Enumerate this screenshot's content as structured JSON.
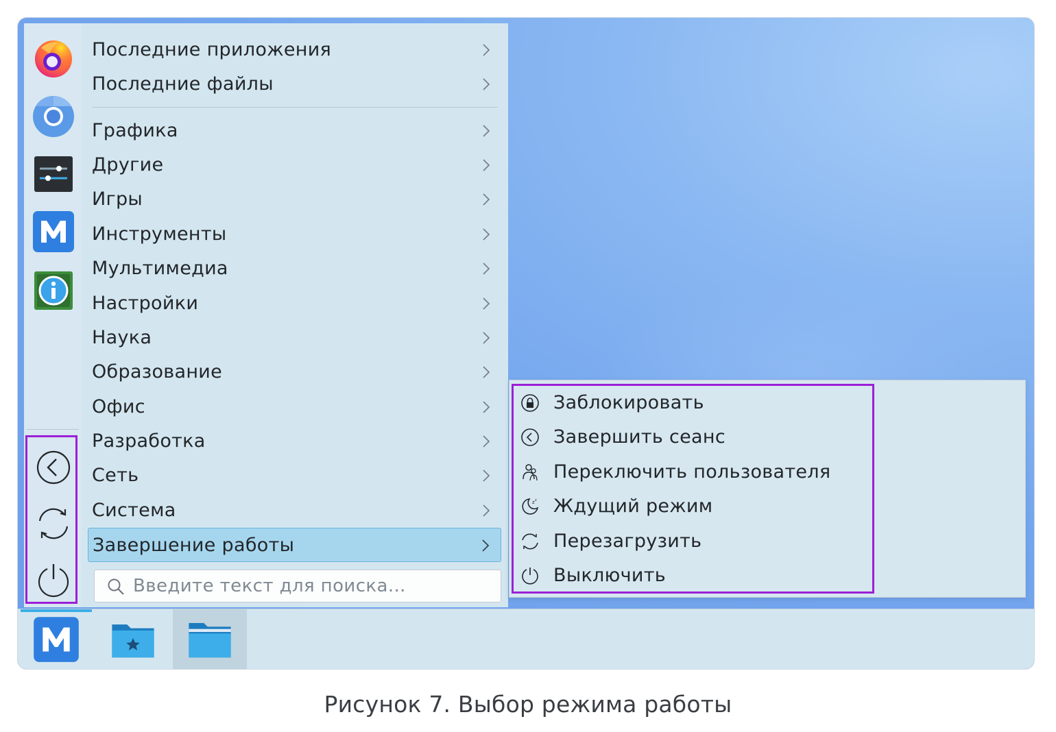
{
  "menu": {
    "categories": [
      {
        "label": "Последние приложения"
      },
      {
        "label": "Последние файлы"
      },
      {
        "label": "Графика"
      },
      {
        "label": "Другие"
      },
      {
        "label": "Игры"
      },
      {
        "label": "Инструменты"
      },
      {
        "label": "Мультимедиа"
      },
      {
        "label": "Настройки"
      },
      {
        "label": "Наука"
      },
      {
        "label": "Образование"
      },
      {
        "label": "Офис"
      },
      {
        "label": "Разработка"
      },
      {
        "label": "Сеть"
      },
      {
        "label": "Система"
      },
      {
        "label": "Завершение работы",
        "active": true
      }
    ],
    "search": {
      "placeholder": "Введите текст для поиска..."
    },
    "favorites": [
      {
        "icon": "firefox-icon"
      },
      {
        "icon": "chromium-icon"
      },
      {
        "icon": "system-settings-icon"
      },
      {
        "icon": "mos-launcher-icon"
      },
      {
        "icon": "system-info-icon"
      }
    ],
    "session_buttons": [
      {
        "icon": "logout-icon"
      },
      {
        "icon": "reboot-icon"
      },
      {
        "icon": "shutdown-icon"
      }
    ]
  },
  "submenu": {
    "items": [
      {
        "label": "Заблокировать",
        "icon": "lock-icon"
      },
      {
        "label": "Завершить сеанс",
        "icon": "logout-icon"
      },
      {
        "label": "Переключить пользователя",
        "icon": "switch-user-icon"
      },
      {
        "label": "Ждущий режим",
        "icon": "sleep-icon"
      },
      {
        "label": "Перезагрузить",
        "icon": "reboot-icon"
      },
      {
        "label": "Выключить",
        "icon": "shutdown-icon"
      }
    ]
  },
  "taskbar": {
    "items": [
      {
        "icon": "mos-launcher-icon"
      },
      {
        "icon": "favorites-folder-icon"
      },
      {
        "icon": "file-manager-icon"
      }
    ]
  },
  "caption": "Рисунок 7. Выбор режима работы",
  "colors": {
    "highlight_border": "#9b20d6",
    "active_item_bg": "#a6d6ee",
    "panel_bg": "#d3e6f0",
    "accent": "#3daee9"
  }
}
